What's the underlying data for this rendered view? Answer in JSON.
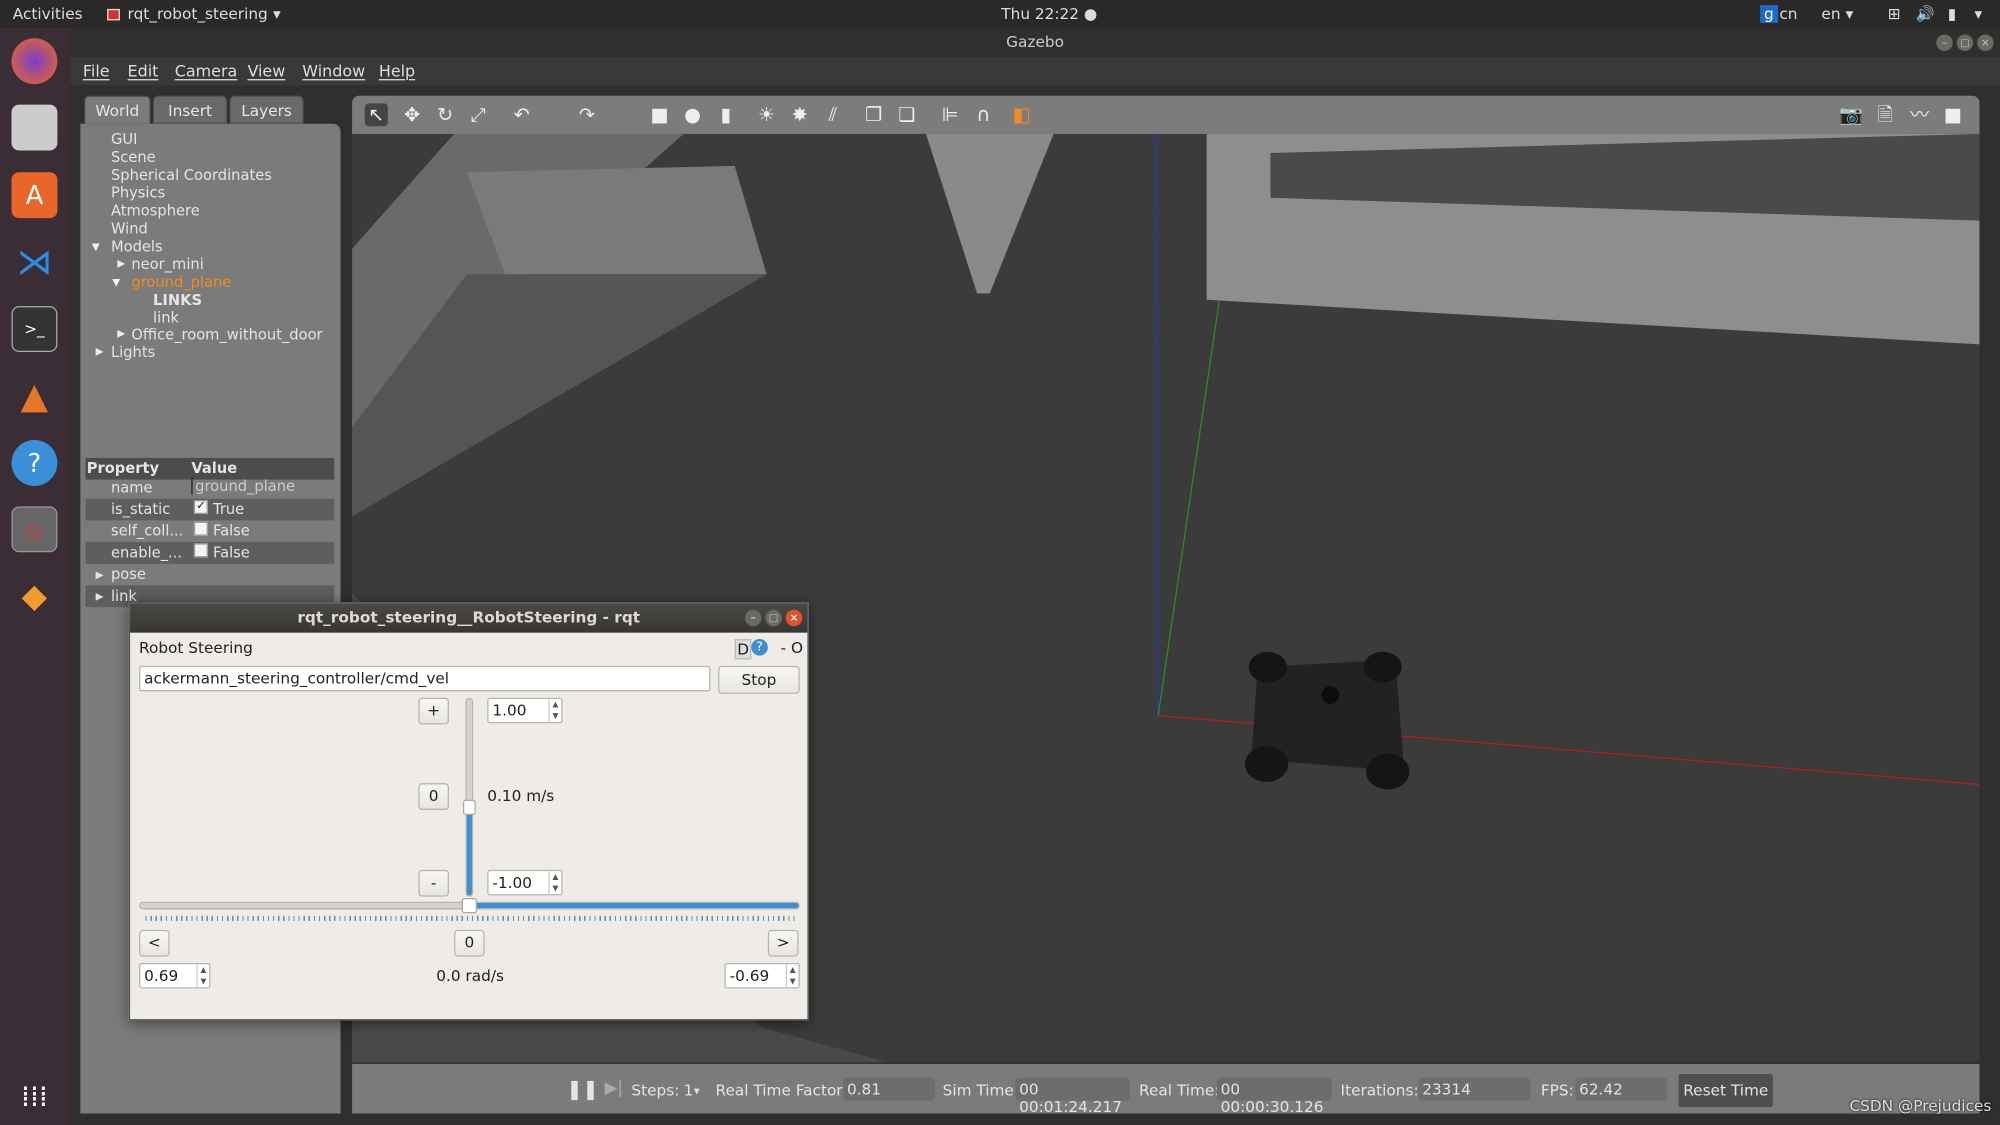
{
  "topbar": {
    "activities": "Activities",
    "app": "rqt_robot_steering",
    "clock": "Thu 22:22 ●",
    "ime": "cn",
    "lang": "en"
  },
  "dock": {
    "items": [
      "firefox-icon",
      "files-icon",
      "software-icon",
      "vscode-icon",
      "terminal-icon",
      "matlab-icon",
      "help-icon",
      "rqt-icon",
      "sublime-icon",
      "apps-grid-icon"
    ]
  },
  "window": {
    "title": "Gazebo"
  },
  "menu": [
    "File",
    "Edit",
    "Camera",
    "View",
    "Window",
    "Help"
  ],
  "left_panel": {
    "tabs": [
      "World",
      "Insert",
      "Layers"
    ],
    "tree": [
      "GUI",
      "Scene",
      "Spherical Coordinates",
      "Physics",
      "Atmosphere",
      "Wind",
      "Models",
      "neor_mini",
      "ground_plane",
      "LINKS",
      "link",
      "Office_room_without_door",
      "Lights"
    ],
    "selected_color": "#f08a24",
    "property_header": [
      "Property",
      "Value"
    ],
    "properties": [
      {
        "name": "name",
        "value": "ground_plane"
      },
      {
        "name": "is_static",
        "value": "True",
        "checked": true
      },
      {
        "name": "self_coll...",
        "value": "False",
        "checked": false
      },
      {
        "name": "enable_...",
        "value": "False",
        "checked": false
      }
    ],
    "groups": [
      "pose",
      "link"
    ]
  },
  "status": {
    "steps_label": "Steps:",
    "steps": "1",
    "rtf_label": "Real Time Factor:",
    "rtf": "0.81",
    "sim_label": "Sim Time:",
    "sim": "00 00:01:24.217",
    "real_label": "Real Time:",
    "real": "00 00:00:30.126",
    "iter_label": "Iterations:",
    "iter": "23314",
    "fps_label": "FPS:",
    "fps": "62.42",
    "reset": "Reset Time"
  },
  "rqt": {
    "title": "rqt_robot_steering__RobotSteering - rqt",
    "plugin": "Robot Steering",
    "plugin_btns": "D",
    "plugin_extra": "- O",
    "topic": "ackermann_steering_controller/cmd_vel",
    "stop": "Stop",
    "plus": "+",
    "zero": "0",
    "minus": "-",
    "lin_max": "1.00",
    "lin_min": "-1.00",
    "lin_value": "0.10 m/s",
    "lin_fraction": 0.55,
    "left": "<",
    "right": ">",
    "ang_zero": "0",
    "ang_max": "0.69",
    "ang_min": "-0.69",
    "ang_value": "0.0 rad/s",
    "ang_fraction": 0.5,
    "accent": "#3d8fd1"
  },
  "watermark": "CSDN @Prejudices"
}
